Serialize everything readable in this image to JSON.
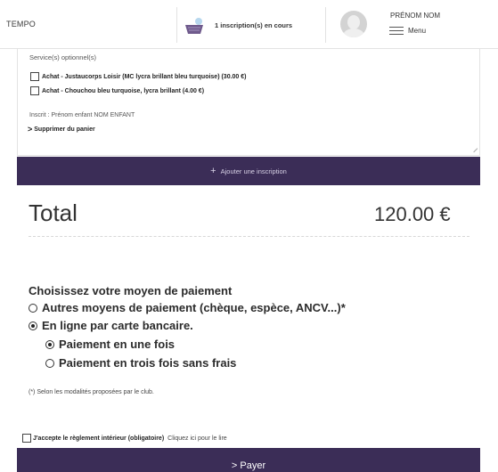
{
  "header": {
    "brand": "TEMPO",
    "basket_count_text": "1 inscription(s) en cours",
    "user_name": "PRÉNOM NOM",
    "menu_label": "Menu"
  },
  "cart": {
    "optional_services_title": "Service(s) optionnel(s)",
    "options": [
      {
        "label": "Achat - Justaucorps Loisir (MC lycra brillant bleu turquoise) (30.00 €)",
        "checked": false
      },
      {
        "label": "Achat - Chouchou bleu turquoise, lycra brillant (4.00 €)",
        "checked": false
      }
    ],
    "inscrit": "Inscrit : Prénom enfant NOM ENFANT",
    "remove_label": "Supprimer du panier"
  },
  "add_inscription": {
    "icon": "plus-icon",
    "label": "Ajouter une inscription"
  },
  "total": {
    "label": "Total",
    "amount": "120.00 €"
  },
  "payment": {
    "title": "Choisissez votre moyen de paiement",
    "methods": [
      {
        "label": "Autres moyens de paiement (chèque, espèce, ANCV...)*",
        "selected": false
      },
      {
        "label": "En ligne par carte bancaire.",
        "selected": true
      }
    ],
    "sub_options": [
      {
        "label": "Paiement en une fois",
        "selected": true
      },
      {
        "label": "Paiement en trois fois sans frais",
        "selected": false
      }
    ],
    "note": "(*) Selon les modalités proposées par le club."
  },
  "accept": {
    "label_bold": "J'accepte le règlement intérieur (obligatoire)",
    "link": "Cliquez ici pour le lire"
  },
  "pay_button": {
    "label": "> Payer"
  },
  "colors": {
    "primary": "#3b2d57",
    "text": "#333333"
  }
}
